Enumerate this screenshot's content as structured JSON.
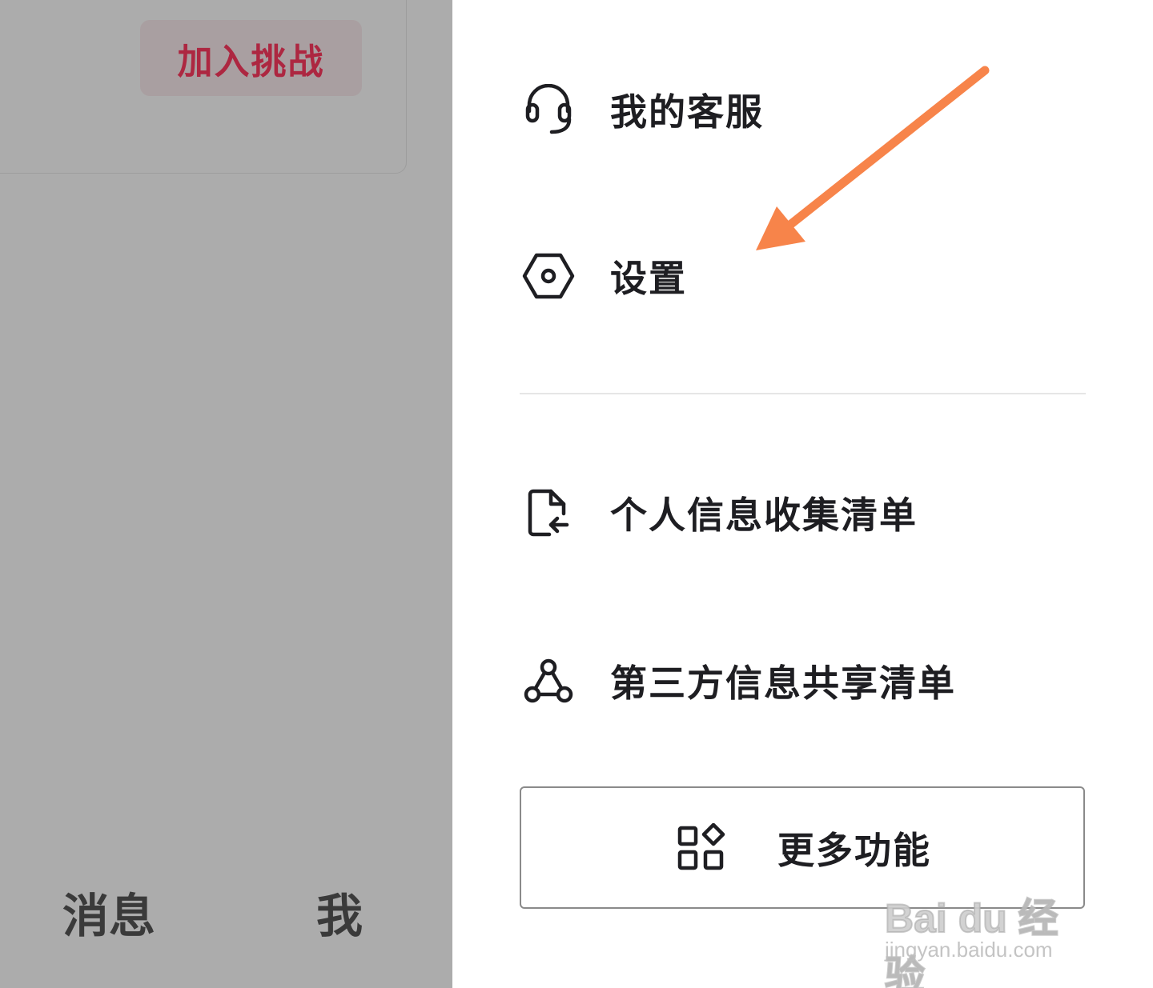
{
  "left_page": {
    "join_button_label": "加入挑战",
    "tabs": [
      "消息",
      "我"
    ]
  },
  "drawer": {
    "items": [
      {
        "label": "我的客服",
        "icon": "headset-icon"
      },
      {
        "label": "设置",
        "icon": "settings-hexagon-icon"
      },
      {
        "label": "个人信息收集清单",
        "icon": "document-return-icon"
      },
      {
        "label": "第三方信息共享清单",
        "icon": "share-network-icon"
      }
    ],
    "more_button": {
      "label": "更多功能",
      "icon": "apps-grid-icon"
    }
  },
  "annotation": {
    "arrow_color": "#f7844a",
    "arrow_target": "设置"
  },
  "watermark": {
    "main": "Bai du 经验",
    "sub": "jingyan.baidu.com"
  }
}
